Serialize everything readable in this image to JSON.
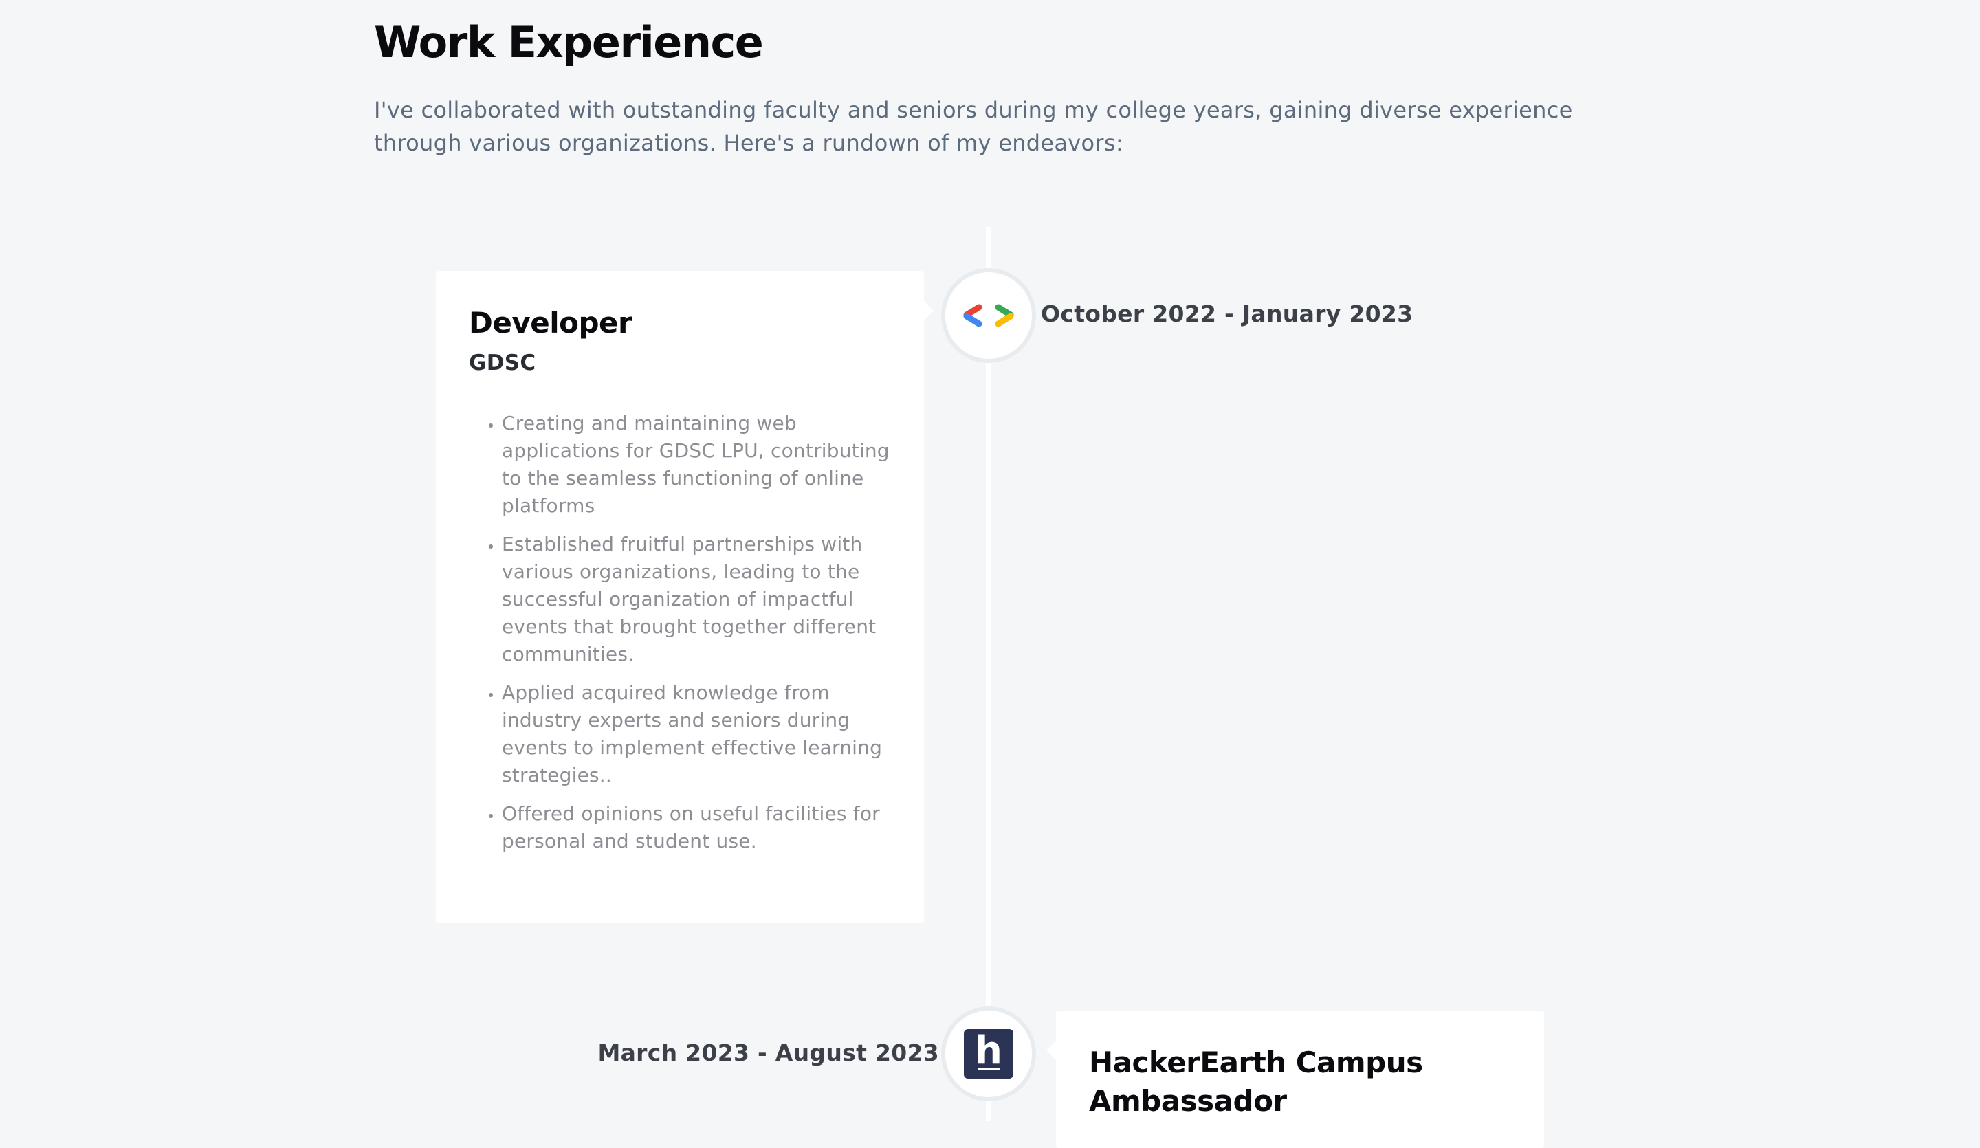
{
  "section": {
    "title": "Work Experience",
    "intro": "I've collaborated with outstanding faculty and seniors during my college years, gaining diverse experience through various organizations. Here's a rundown of my endeavors:"
  },
  "experiences": [
    {
      "role": "Developer",
      "company": "GDSC",
      "date": "October 2022 - January 2023",
      "icon": "gdsc-logo-icon",
      "points": [
        "Creating and maintaining web applications for GDSC LPU, contributing to the seamless functioning of online platforms",
        "Established fruitful partnerships with various organizations, leading to the successful organization of impactful events that brought together different communities.",
        "Applied acquired knowledge from industry experts and seniors during events to implement effective learning strategies..",
        "Offered opinions on useful facilities for personal and student use."
      ]
    },
    {
      "role": "HackerEarth Campus Ambassador",
      "date": "March 2023 - August 2023",
      "icon": "hackerearth-logo-icon",
      "icon_letter": "h"
    }
  ],
  "colors": {
    "background": "#f5f6f8",
    "card": "#ffffff",
    "gdsc_red": "#ea4335",
    "gdsc_blue": "#4285f4",
    "gdsc_green": "#34a853",
    "gdsc_yellow": "#fbbc04",
    "hackerearth_navy": "#2b3454"
  }
}
